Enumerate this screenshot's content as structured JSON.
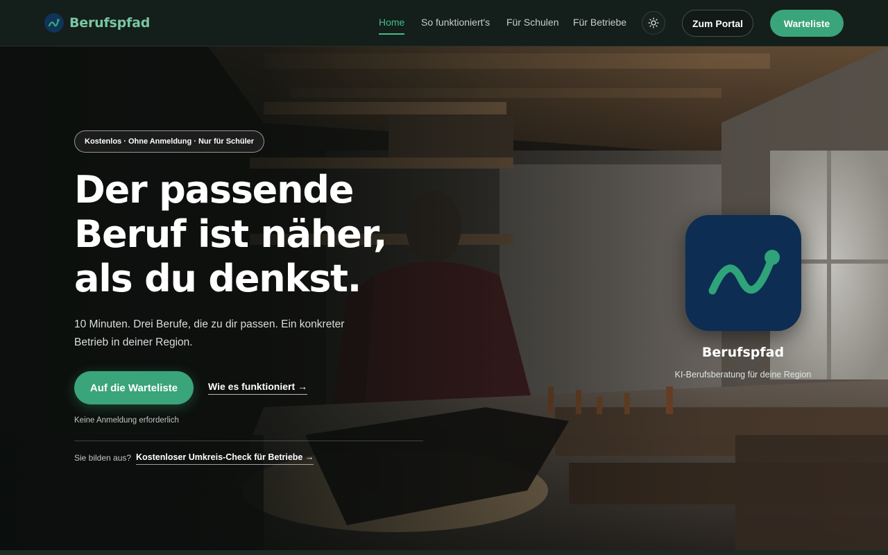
{
  "header": {
    "brand": "Berufspfad",
    "nav": [
      {
        "label": "Home"
      },
      {
        "label": "So funktioniert's"
      },
      {
        "label": "Für Schulen"
      },
      {
        "label": "Für Betriebe"
      }
    ],
    "theme_icon": "sun-icon",
    "portal_label": "Zum Portal",
    "waitlist_label": "Warteliste"
  },
  "hero": {
    "pill": "Kostenlos · Ohne Anmeldung · Nur für Schüler",
    "headline_lines": [
      "Der passende",
      "Beruf ist näher,",
      "als du denkst."
    ],
    "subline": "10 Minuten. Drei Berufe, die zu dir passen. Ein konkreter Betrieb in deiner Region.",
    "cta_primary": "Auf die Warteliste",
    "cta_secondary": "Wie es funktioniert →",
    "no_login": "Keine Anmeldung erforderlich",
    "training_question": "Sie bilden aus?",
    "training_link": "Kostenloser Umkreis-Check für Betriebe →"
  },
  "app_card": {
    "name": "Berufspfad",
    "tagline": "KI-Berufsberatung für deine Region"
  },
  "colors": {
    "accent": "#3aa47a",
    "accent_text": "#3fbf8c",
    "header_bg": "#141e1a",
    "brand_text": "#79c7a3",
    "icon_bg": "#0d2d52"
  }
}
